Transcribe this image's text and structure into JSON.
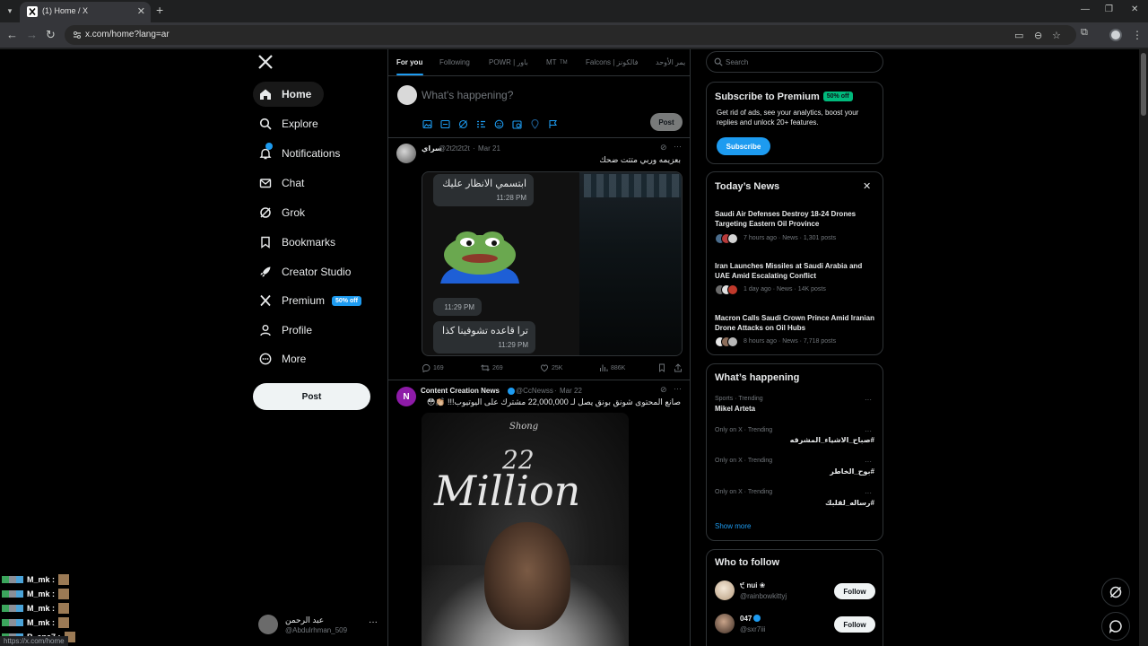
{
  "browser": {
    "tab_title": "(1) Home / X",
    "url": "x.com/home?lang=ar"
  },
  "nav": {
    "items": [
      {
        "label": "Home",
        "icon": "home-icon"
      },
      {
        "label": "Explore",
        "icon": "search-icon"
      },
      {
        "label": "Notifications",
        "icon": "bell-icon"
      },
      {
        "label": "Chat",
        "icon": "mail-icon"
      },
      {
        "label": "Grok",
        "icon": "grok-icon"
      },
      {
        "label": "Bookmarks",
        "icon": "bookmark-icon"
      },
      {
        "label": "Creator Studio",
        "icon": "rocket-icon"
      },
      {
        "label": "Premium",
        "icon": "x-icon"
      },
      {
        "label": "Profile",
        "icon": "person-icon"
      },
      {
        "label": "More",
        "icon": "more-circle-icon"
      }
    ],
    "premium_badge": "50% off",
    "post_button": "Post",
    "account": {
      "name": "عبد الرحمن",
      "handle": "@Abdulrhman_509"
    }
  },
  "chat_overlay": [
    {
      "user": "M_mk :"
    },
    {
      "user": "M_mk :"
    },
    {
      "user": "M_mk :"
    },
    {
      "user": "M_mk :"
    },
    {
      "user": "R_ana7 :"
    }
  ],
  "feed_tabs": [
    "For you",
    "Following",
    "POWR | باور",
    "MT",
    "TM",
    "Falcons | فالكونز",
    "يمر الأوحد"
  ],
  "compose": {
    "placeholder": "What's happening?",
    "post_label": "Post"
  },
  "tweets": [
    {
      "name": "سراي",
      "handle": "@2t2t2t2t",
      "date": "Mar 21",
      "text": "بعزيمه وربي متتت ضحك",
      "media": {
        "bubble1_text": "ابتسمي الانظار عليك",
        "bubble1_time": "11:28 PM",
        "bubble2_time": "11:29 PM",
        "bubble3_text": "ترا قاعده تشوفينا كذا",
        "bubble3_time": "11:29 PM"
      },
      "stats": {
        "replies": "169",
        "reposts": "269",
        "likes": "25K",
        "views": "886K"
      }
    },
    {
      "name": "Content Creation News",
      "handle": "@CcNewss",
      "date": "Mar 22",
      "text": "صانع المحتوى شونق بونق يصل لـ 22,000,000 مشترك على اليوتيوب!!! 👏🏼😳",
      "media": {
        "number": "22",
        "word": "Million",
        "sig": "Shong"
      }
    }
  ],
  "search": {
    "placeholder": "Search"
  },
  "premium_card": {
    "title": "Subscribe to Premium",
    "badge": "50% off",
    "desc": "Get rid of ads, see your analytics, boost your replies and unlock 20+ features.",
    "button": "Subscribe"
  },
  "news": {
    "title": "Today’s News",
    "items": [
      {
        "headline": "Saudi Air Defenses Destroy 18-24 Drones Targeting Eastern Oil Province",
        "meta": "7 hours ago · News · 1,301 posts"
      },
      {
        "headline": "Iran Launches Missiles at Saudi Arabia and UAE Amid Escalating Conflict",
        "meta": "1 day ago · News · 14K posts"
      },
      {
        "headline": "Macron Calls Saudi Crown Prince Amid Iranian Drone Attacks on Oil Hubs",
        "meta": "8 hours ago · News · 7,718 posts"
      }
    ]
  },
  "happening": {
    "title": "What’s happening",
    "trends": [
      {
        "category": "Sports · Trending",
        "name": "Mikel Arteta"
      },
      {
        "category": "Only on X · Trending",
        "name": "#صباح_الاشياء_المشرقه"
      },
      {
        "category": "Only on X · Trending",
        "name": "#بوح_الخاطر"
      },
      {
        "category": "Only on X · Trending",
        "name": "#رساله_لقلبك"
      }
    ],
    "show_more": "Show more"
  },
  "who_to_follow": {
    "title": "Who to follow",
    "users": [
      {
        "name": "੯ nui ❀",
        "handle": "@rainbowkittyj",
        "button": "Follow"
      },
      {
        "name": "047",
        "handle": "@sxr7iii",
        "button": "Follow"
      }
    ]
  },
  "status_url": "https://x.com/home",
  "colors": {
    "accent": "#1d9bf0",
    "background": "#000000",
    "border": "#2f3336",
    "muted": "#71767b"
  }
}
